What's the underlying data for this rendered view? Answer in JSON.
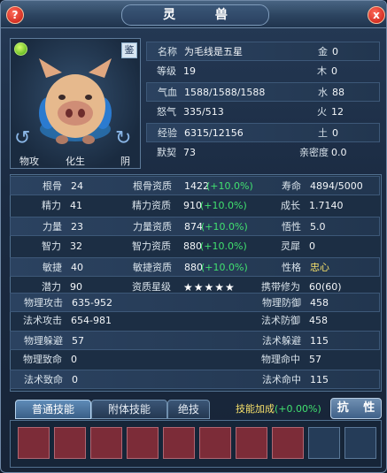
{
  "window": {
    "title": "灵 兽"
  },
  "controls": {
    "help": "?",
    "close": "x"
  },
  "portrait": {
    "badge": "鉴",
    "labels": [
      "物攻",
      "化生",
      "阴"
    ]
  },
  "info": [
    {
      "label": "名称",
      "value": "为毛线是五星",
      "elem_label": "金",
      "elem_value": "0"
    },
    {
      "label": "等级",
      "value": "19",
      "elem_label": "木",
      "elem_value": "0"
    },
    {
      "label": "气血",
      "value": "1588/1588/1588",
      "elem_label": "水",
      "elem_value": "88"
    },
    {
      "label": "怒气",
      "value": "335/513",
      "elem_label": "火",
      "elem_value": "12"
    },
    {
      "label": "经验",
      "value": "6315/12156",
      "elem_label": "土",
      "elem_value": "0"
    },
    {
      "label": "默契",
      "value": "73",
      "elem_label": "亲密度",
      "elem_value": "0.0"
    }
  ],
  "attributes": [
    {
      "l1": "根骨",
      "v1": "24",
      "l2": "根骨资质",
      "v2": "1422",
      "p2": "(+10.0%)",
      "l3": "寿命",
      "v3": "4894/5000"
    },
    {
      "l1": "精力",
      "v1": "41",
      "l2": "精力资质",
      "v2": "910",
      "p2": "(+10.0%)",
      "l3": "成长",
      "v3": "1.7140"
    },
    {
      "l1": "力量",
      "v1": "23",
      "l2": "力量资质",
      "v2": "874",
      "p2": "(+10.0%)",
      "l3": "悟性",
      "v3": "5.0"
    },
    {
      "l1": "智力",
      "v1": "32",
      "l2": "智力资质",
      "v2": "880",
      "p2": "(+10.0%)",
      "l3": "灵犀",
      "v3": "0"
    },
    {
      "l1": "敏捷",
      "v1": "40",
      "l2": "敏捷资质",
      "v2": "880",
      "p2": "(+10.0%)",
      "l3": "性格",
      "v3": "忠心"
    },
    {
      "l1": "潜力",
      "v1": "90",
      "l2": "资质星级",
      "v2": "★★★★★",
      "p2": "",
      "l3": "携带修为",
      "v3": "60(60)"
    }
  ],
  "combat": [
    {
      "l1": "物理攻击",
      "v1": "635-952",
      "l2": "物理防御",
      "v2": "458"
    },
    {
      "l1": "法术攻击",
      "v1": "654-981",
      "l2": "法术防御",
      "v2": "458"
    },
    {
      "l1": "物理躲避",
      "v1": "57",
      "l2": "法术躲避",
      "v2": "115"
    },
    {
      "l1": "物理致命",
      "v1": "0",
      "l2": "物理命中",
      "v2": "57"
    },
    {
      "l1": "法术致命",
      "v1": "0",
      "l2": "法术命中",
      "v2": "115"
    }
  ],
  "tabs": [
    "普通技能",
    "附体技能",
    "绝技"
  ],
  "skill_bonus": {
    "label": "技能加成",
    "value": "(+0.00%)"
  },
  "resist_button": "抗 性",
  "skill_slots": {
    "filled": 8,
    "empty": 2
  },
  "colors": {
    "accent_green": "#41e06f",
    "highlight_yellow": "#f6e06a",
    "slot_filled": "#7c2c38"
  }
}
